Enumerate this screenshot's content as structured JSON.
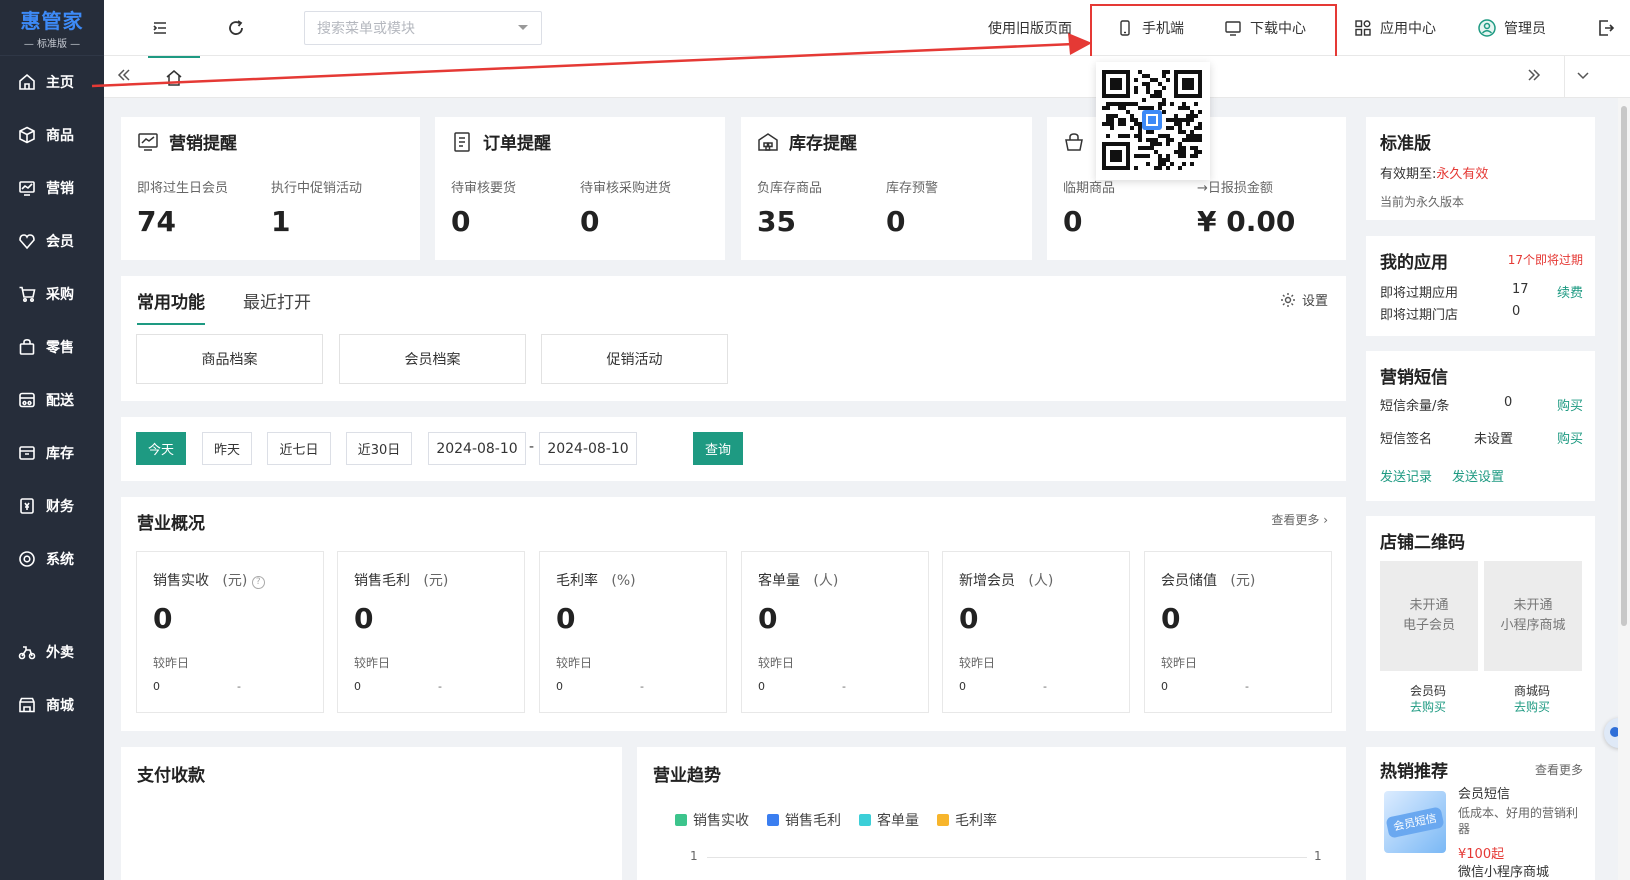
{
  "brand": {
    "name": "惠管家",
    "edition": "标准版"
  },
  "nav": [
    {
      "label": "主页",
      "icon": "home-icon"
    },
    {
      "label": "商品",
      "icon": "cube-icon"
    },
    {
      "label": "营销",
      "icon": "chart-icon"
    },
    {
      "label": "会员",
      "icon": "diamond-icon"
    },
    {
      "label": "采购",
      "icon": "cart-icon"
    },
    {
      "label": "零售",
      "icon": "bag-icon"
    },
    {
      "label": "配送",
      "icon": "truck-icon"
    },
    {
      "label": "库存",
      "icon": "box-icon"
    },
    {
      "label": "财务",
      "icon": "yen-icon"
    },
    {
      "label": "系统",
      "icon": "settings-icon"
    },
    {
      "label": "外卖",
      "icon": "scooter-icon"
    },
    {
      "label": "商城",
      "icon": "shop-icon"
    }
  ],
  "topbar": {
    "search_placeholder": "搜索菜单或模块",
    "old_version": "使用旧版页面",
    "mobile": "手机端",
    "download": "下载中心",
    "app_center": "应用中心",
    "admin": "管理员"
  },
  "reminders": {
    "marketing": {
      "title": "营销提醒",
      "l1": "即将过生日会员",
      "v1": "74",
      "l2": "执行中促销活动",
      "v2": "1"
    },
    "order": {
      "title": "订单提醒",
      "l1": "待审核要货",
      "v1": "0",
      "l2": "待审核采购进货",
      "v2": "0"
    },
    "stock": {
      "title": "库存提醒",
      "l1": "负库存商品",
      "v1": "35",
      "l2": "库存预警",
      "v2": "0"
    },
    "expiry": {
      "l1": "临期商品",
      "v1": "0",
      "l2": "日报损金额",
      "v2": "¥ 0.00"
    }
  },
  "functions": {
    "tabs": [
      "常用功能",
      "最近打开"
    ],
    "settings": "设置",
    "buttons": [
      "商品档案",
      "会员档案",
      "促销活动"
    ]
  },
  "filter": {
    "buttons": [
      "今天",
      "昨天",
      "近七日",
      "近30日"
    ],
    "date_from": "2024-08-10",
    "date_sep": "-",
    "date_to": "2024-08-10",
    "query": "查询"
  },
  "overview": {
    "title": "营业概况",
    "more": "查看更多",
    "compare_label": "较昨日",
    "kpis": [
      {
        "label": "销售实收",
        "unit": "(元)",
        "value": "0",
        "prev": "0",
        "diff": "-"
      },
      {
        "label": "销售毛利",
        "unit": "(元)",
        "value": "0",
        "prev": "0",
        "diff": "-"
      },
      {
        "label": "毛利率",
        "unit": "(%)",
        "value": "0",
        "prev": "0",
        "diff": "-"
      },
      {
        "label": "客单量",
        "unit": "(人)",
        "value": "0",
        "prev": "0",
        "diff": "-"
      },
      {
        "label": "新增会员",
        "unit": "(人)",
        "value": "0",
        "prev": "0",
        "diff": "-"
      },
      {
        "label": "会员储值",
        "unit": "(元)",
        "value": "0",
        "prev": "0",
        "diff": "-"
      }
    ]
  },
  "payment": {
    "title": "支付收款"
  },
  "trend": {
    "title": "营业趋势",
    "legend": [
      {
        "name": "销售实收",
        "color": "#3cc48c"
      },
      {
        "name": "销售毛利",
        "color": "#3b7ef0"
      },
      {
        "name": "客单量",
        "color": "#3ccfd8"
      },
      {
        "name": "毛利率",
        "color": "#f7b52c"
      }
    ],
    "y_left": "1",
    "y_right": "1"
  },
  "edition": {
    "title": "标准版",
    "valid_label": "有效期至:",
    "valid_value": "永久有效",
    "note": "当前为永久版本"
  },
  "my_apps": {
    "title": "我的应用",
    "alert": "17个即将过期",
    "r1_label": "即将过期应用",
    "r1_value": "17",
    "r1_action": "续费",
    "r2_label": "即将过期门店",
    "r2_value": "0"
  },
  "sms": {
    "title": "营销短信",
    "r1_label": "短信余量/条",
    "r1_value": "0",
    "r1_action": "购买",
    "r2_label": "短信签名",
    "r2_value": "未设置",
    "r2_action": "购买",
    "link1": "发送记录",
    "link2": "发送设置"
  },
  "qrcode": {
    "title": "店铺二维码",
    "a_line1": "未开通",
    "a_line2": "电子会员",
    "a_name": "会员码",
    "a_action": "去购买",
    "b_line1": "未开通",
    "b_line2": "小程序商城",
    "b_name": "商城码",
    "b_action": "去购买"
  },
  "hot": {
    "title": "热销推荐",
    "more": "查看更多",
    "item1_title": "会员短信",
    "item1_desc": "低成本、好用的营销利器",
    "item1_price": "¥100起",
    "item2_title": "微信小程序商城"
  },
  "colors": {
    "accent": "#1e9a82",
    "sidebar": "#262d3a",
    "alert": "#e53935",
    "brand_blue": "#3d8af7"
  }
}
